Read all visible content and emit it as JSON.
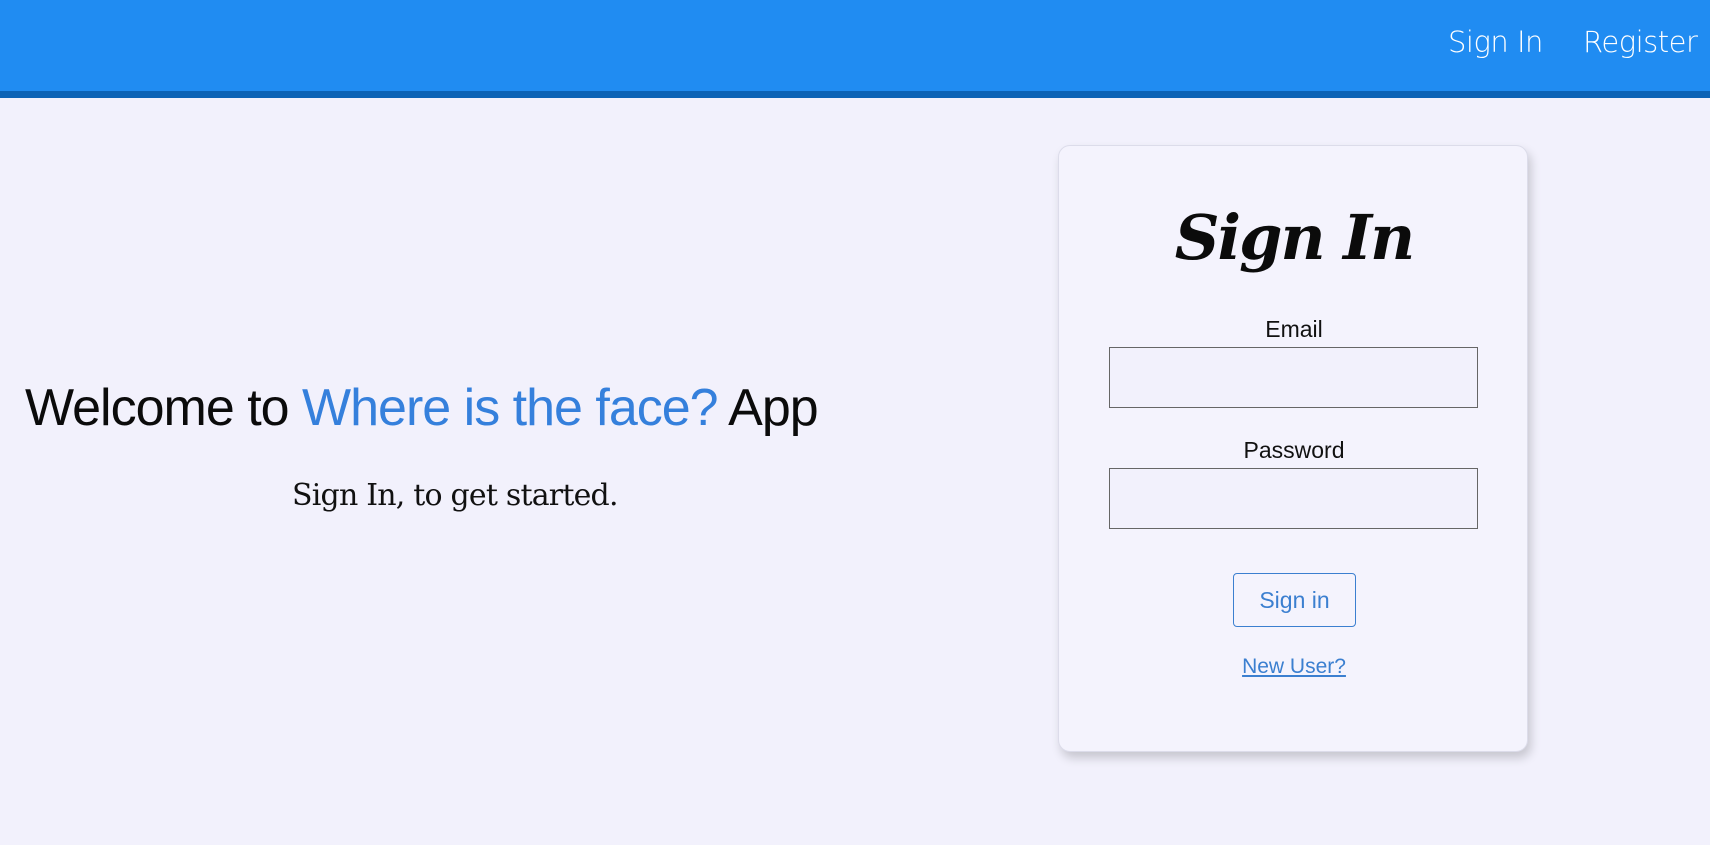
{
  "nav": {
    "sign_in": "Sign In",
    "register": "Register"
  },
  "hero": {
    "title_prefix": "Welcome to ",
    "title_accent": "Where is the face?",
    "title_suffix": " App",
    "subtitle": "Sign In, to get started."
  },
  "signin_form": {
    "title": "Sign In",
    "email_label": "Email",
    "email_value": "",
    "password_label": "Password",
    "password_value": "",
    "submit_label": "Sign in",
    "new_user_link": "New User?"
  },
  "colors": {
    "header_bg": "#208cf2",
    "header_border": "#0d63b6",
    "page_bg": "#f2f1fc",
    "accent": "#3580dc"
  }
}
